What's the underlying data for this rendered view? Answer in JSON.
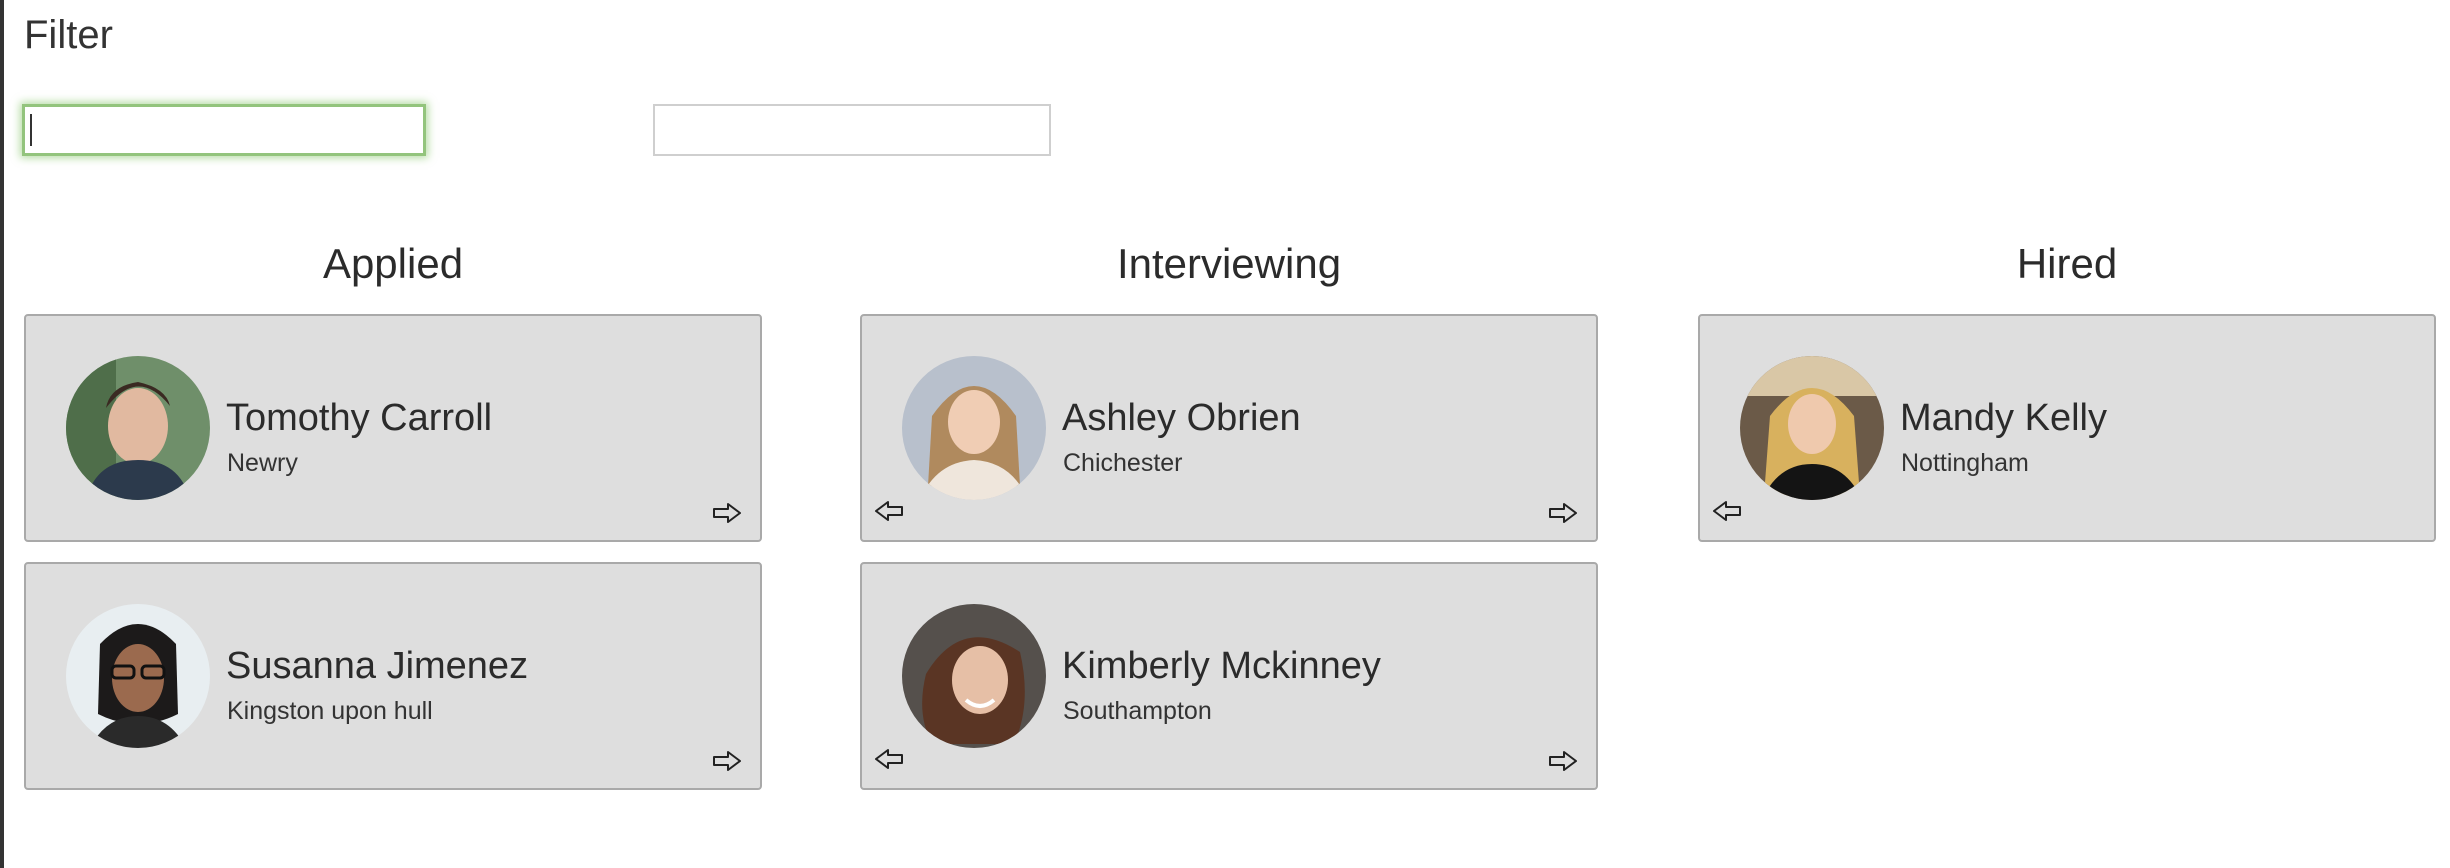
{
  "filter": {
    "title": "Filter",
    "name_value": "",
    "city_value": ""
  },
  "columns": [
    {
      "title": "Applied",
      "cards": [
        {
          "name": "Tomothy Carroll",
          "city": "Newry",
          "avatar_icon": "person-photo"
        },
        {
          "name": "Susanna Jimenez",
          "city": "Kingston upon hull",
          "avatar_icon": "person-photo"
        }
      ]
    },
    {
      "title": "Interviewing",
      "cards": [
        {
          "name": "Ashley Obrien",
          "city": "Chichester",
          "avatar_icon": "person-photo"
        },
        {
          "name": "Kimberly Mckinney",
          "city": "Southampton",
          "avatar_icon": "person-photo"
        }
      ]
    },
    {
      "title": "Hired",
      "cards": [
        {
          "name": "Mandy Kelly",
          "city": "Nottingham",
          "avatar_icon": "person-photo"
        }
      ]
    }
  ],
  "colors": {
    "card_background": "#dedede",
    "card_border": "#a9a9a9",
    "focus_border": "#93c47d"
  }
}
